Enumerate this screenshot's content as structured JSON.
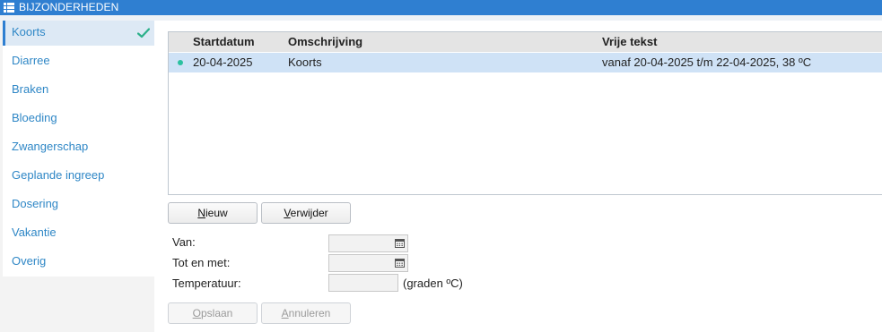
{
  "window": {
    "title": "BIJZONDERHEDEN"
  },
  "sidebar": {
    "items": [
      {
        "label": "Koorts",
        "active": true
      },
      {
        "label": "Diarree"
      },
      {
        "label": "Braken"
      },
      {
        "label": "Bloeding"
      },
      {
        "label": "Zwangerschap"
      },
      {
        "label": "Geplande ingreep"
      },
      {
        "label": "Dosering"
      },
      {
        "label": "Vakantie"
      },
      {
        "label": "Overig"
      }
    ]
  },
  "table": {
    "columns": [
      "Startdatum",
      "Omschrijving",
      "Vrije tekst"
    ],
    "rows": [
      {
        "startdatum": "20-04-2025",
        "omschrijving": "Koorts",
        "vrije_tekst": "vanaf 20-04-2025 t/m 22-04-2025, 38 ºC",
        "status_color": "#2bc1a0"
      }
    ]
  },
  "buttons": {
    "nieuw": {
      "first": "N",
      "rest": "ieuw"
    },
    "verwijder": {
      "first": "V",
      "rest": "erwijder"
    },
    "opslaan": {
      "first": "O",
      "rest": "pslaan"
    },
    "annuleren": {
      "first": "A",
      "rest": "nnuleren"
    }
  },
  "form": {
    "van_label": "Van:",
    "van_value": "",
    "tot_label": "Tot en met:",
    "tot_value": "",
    "temp_label": "Temperatuur:",
    "temp_value": "",
    "temp_unit": "(graden ºC)"
  },
  "colors": {
    "accent": "#2f7fd1",
    "link": "#2f87c6",
    "selection": "#cfe2f6",
    "status_dot": "#2bc1a0",
    "check": "#2bb08a"
  },
  "icons": {
    "title": "list-icon",
    "active_item": "check-icon",
    "date_fields": "calendar-icon"
  }
}
